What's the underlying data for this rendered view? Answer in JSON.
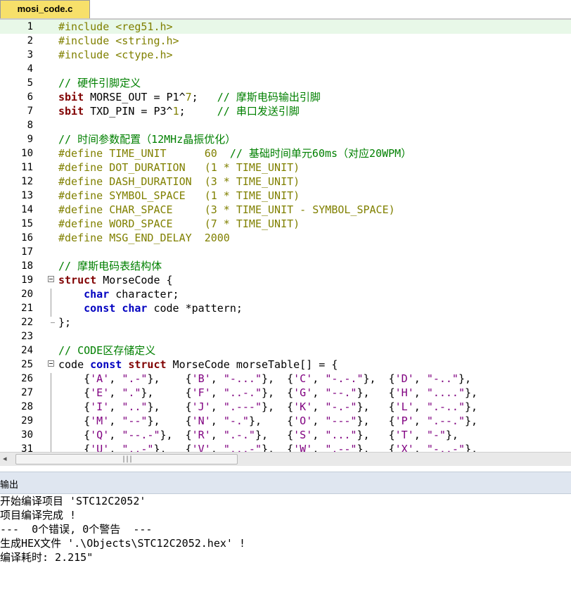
{
  "tab": {
    "filename": "mosi_code.c"
  },
  "editor": {
    "lines": [
      {
        "n": "1",
        "code": "#include <reg51.h>"
      },
      {
        "n": "2",
        "code": "#include <string.h>"
      },
      {
        "n": "3",
        "code": "#include <ctype.h>"
      },
      {
        "n": "4",
        "code": ""
      },
      {
        "n": "5",
        "code": "// 硬件引脚定义"
      },
      {
        "n": "6",
        "code": "sbit MORSE_OUT = P1^7;   // 摩斯电码输出引脚"
      },
      {
        "n": "7",
        "code": "sbit TXD_PIN = P3^1;     // 串口发送引脚"
      },
      {
        "n": "8",
        "code": ""
      },
      {
        "n": "9",
        "code": "// 时间参数配置（12MHz晶振优化）"
      },
      {
        "n": "10",
        "code": "#define TIME_UNIT      60  // 基础时间单元60ms（对应20WPM）"
      },
      {
        "n": "11",
        "code": "#define DOT_DURATION   (1 * TIME_UNIT)"
      },
      {
        "n": "12",
        "code": "#define DASH_DURATION  (3 * TIME_UNIT)"
      },
      {
        "n": "13",
        "code": "#define SYMBOL_SPACE   (1 * TIME_UNIT)"
      },
      {
        "n": "14",
        "code": "#define CHAR_SPACE     (3 * TIME_UNIT - SYMBOL_SPACE)"
      },
      {
        "n": "15",
        "code": "#define WORD_SPACE     (7 * TIME_UNIT)"
      },
      {
        "n": "16",
        "code": "#define MSG_END_DELAY  2000"
      },
      {
        "n": "17",
        "code": ""
      },
      {
        "n": "18",
        "code": "// 摩斯电码表结构体"
      },
      {
        "n": "19",
        "code": "struct MorseCode {"
      },
      {
        "n": "20",
        "code": "    char character;"
      },
      {
        "n": "21",
        "code": "    const char code *pattern;"
      },
      {
        "n": "22",
        "code": "};"
      },
      {
        "n": "23",
        "code": ""
      },
      {
        "n": "24",
        "code": "// CODE区存储定义"
      },
      {
        "n": "25",
        "code": "code const struct MorseCode morseTable[] = {"
      },
      {
        "n": "26",
        "code": "    {'A', \".-\"},    {'B', \"-...\"},  {'C', \"-.-.\"},  {'D', \"-..\"},"
      },
      {
        "n": "27",
        "code": "    {'E', \".\"},     {'F', \"..-.\"},  {'G', \"--.\"},   {'H', \"....\"},"
      },
      {
        "n": "28",
        "code": "    {'I', \"..\"},    {'J', \".---\"},  {'K', \"-.-\"},   {'L', \".-..\"},"
      },
      {
        "n": "29",
        "code": "    {'M', \"--\"},    {'N', \"-.\"},    {'O', \"---\"},   {'P', \".--.\"},"
      },
      {
        "n": "30",
        "code": "    {'Q', \"--.-\"},  {'R', \".-.\"},   {'S', \"...\"},   {'T', \"-\"},"
      },
      {
        "n": "31",
        "code": "    {'U', \"..-\"},   {'V', \"...-\"},  {'W', \".--\"},   {'X', \"-..-\"},"
      }
    ]
  },
  "output": {
    "title": "输出",
    "lines": [
      "开始编译项目 'STC12C2052'",
      "项目编译完成 !",
      "---  0个错误, 0个警告  ---",
      "生成HEX文件 '.\\Objects\\STC12C2052.hex' !",
      "编译耗时: 2.215\""
    ]
  },
  "scrollbar": {
    "left_arrow": "◂",
    "grip": "|||"
  }
}
